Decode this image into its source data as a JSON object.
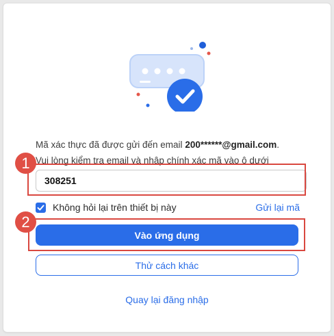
{
  "verification": {
    "line1_prefix": "Mã xác thực đã được gửi đến email ",
    "email": "200******@gmail.com",
    "line1_suffix": ".",
    "line2": "Vui lòng kiểm tra email và nhập chính xác mã vào ô dưới",
    "code_value": "308251"
  },
  "remember": {
    "label": "Không hỏi lại trên thiết bị này",
    "checked": true
  },
  "resend_label": "Gửi lại mã",
  "primary_button": "Vào ứng dụng",
  "secondary_button": "Thử cách khác",
  "back_link": "Quay lại đăng nhập",
  "annotations": [
    "1",
    "2"
  ],
  "icons": [
    "message-bubble-icon",
    "check-badge-icon",
    "checkbox-check-icon"
  ],
  "colors": {
    "accent": "#2a6de8",
    "annotation": "#d9473f"
  }
}
